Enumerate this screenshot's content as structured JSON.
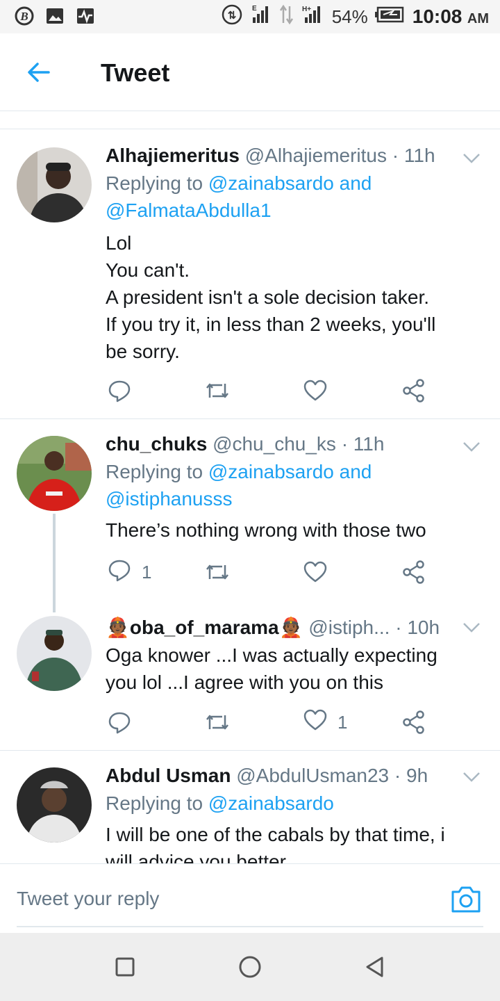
{
  "status_bar": {
    "battery": "54%",
    "time": "10:08",
    "ampm": "AM",
    "icons": [
      "b-circle-icon",
      "image-icon",
      "pulse-icon",
      "hotspot-icon",
      "signal-e-icon",
      "data-arrows-icon",
      "signal-h-icon",
      "battery-icon"
    ]
  },
  "header": {
    "title": "Tweet"
  },
  "tweets": [
    {
      "name": "Alhajiemeritus",
      "handle": "@Alhajiemeritus",
      "time": "· 11h",
      "replying_prefix": "Replying to",
      "replying_to": "@zainabsardo and",
      "replying_to_2": "@FalmataAbdulla1",
      "lines": [
        "Lol",
        "You can't.",
        "A president isn't a sole decision taker.",
        "If you try it, in  less than 2 weeks, you'll",
        "be sorry."
      ]
    },
    {
      "name": "chu_chuks",
      "handle": "@chu_chu_ks",
      "time": "· 11h",
      "replying_prefix": "Replying to",
      "replying_to": "@zainabsardo and",
      "replying_to_2": "@istiphanusss",
      "lines": [
        "There’s nothing wrong with those two"
      ],
      "reply_count": "1"
    },
    {
      "name_prefix": "👲🏾",
      "name": "oba_of_marama",
      "name_suffix": "👲🏾",
      "handle": "@istiph...",
      "time": "· 10h",
      "lines": [
        "Oga knower ...I was actually expecting",
        "you lol ...I agree with you on this"
      ],
      "like_count": "1"
    },
    {
      "name": "Abdul Usman",
      "handle": "@AbdulUsman23",
      "time": "· 9h",
      "replying_prefix": "Replying to",
      "replying_to": "@zainabsardo",
      "lines": [
        "I will be one of the cabals by that time, i",
        "will advice you better"
      ]
    }
  ],
  "reply_bar": {
    "placeholder": "Tweet your reply"
  },
  "colors": {
    "accent": "#1da1f2",
    "secondary_text": "#657786",
    "divider": "#e1e8ed"
  }
}
